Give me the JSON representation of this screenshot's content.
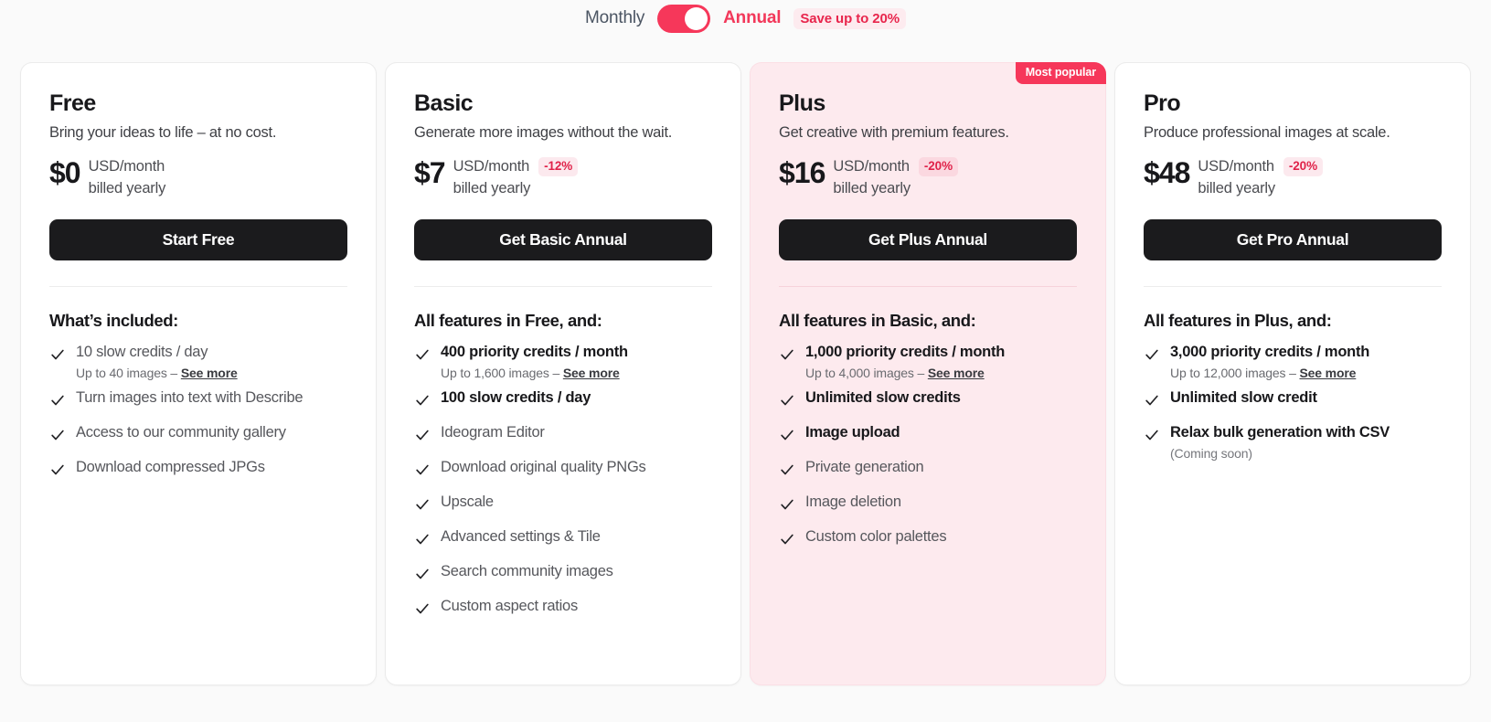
{
  "billing_toggle": {
    "monthly_label": "Monthly",
    "annual_label": "Annual",
    "save_label": "Save up to 20%",
    "selected": "Annual",
    "accent_color": "#f6375a",
    "save_bg_color": "#fdebef"
  },
  "badge": {
    "most_popular": "Most popular"
  },
  "plans": [
    {
      "name": "Free",
      "tagline": "Bring your ideas to life – at no cost.",
      "price": "$0",
      "unit": "USD/month",
      "billed": "billed yearly",
      "discount": "",
      "cta": "Start Free",
      "included_title": "What’s included:",
      "features": [
        {
          "text": "10 slow credits / day",
          "bold": false,
          "sub_prefix": "Up to 40 images – ",
          "sub_link": "See more"
        },
        {
          "text": "Turn images into text with Describe",
          "bold": false
        },
        {
          "text": "Access to our community gallery",
          "bold": false
        },
        {
          "text": "Download compressed JPGs",
          "bold": false
        }
      ]
    },
    {
      "name": "Basic",
      "tagline": "Generate more images without the wait.",
      "price": "$7",
      "unit": "USD/month",
      "billed": "billed yearly",
      "discount": "-12%",
      "cta": "Get Basic Annual",
      "included_title": "All features in Free, and:",
      "features": [
        {
          "text": "400 priority credits / month",
          "bold": true,
          "sub_prefix": "Up to 1,600 images – ",
          "sub_link": "See more"
        },
        {
          "text": "100 slow credits / day",
          "bold": true
        },
        {
          "text": "Ideogram Editor",
          "bold": false
        },
        {
          "text": "Download original quality PNGs",
          "bold": false
        },
        {
          "text": "Upscale",
          "bold": false
        },
        {
          "text": "Advanced settings & Tile",
          "bold": false
        },
        {
          "text": "Search community images",
          "bold": false
        },
        {
          "text": "Custom aspect ratios",
          "bold": false
        }
      ]
    },
    {
      "name": "Plus",
      "tagline": "Get creative with premium features.",
      "price": "$16",
      "unit": "USD/month",
      "billed": "billed yearly",
      "discount": "-20%",
      "cta": "Get Plus Annual",
      "included_title": "All features in Basic, and:",
      "highlight": true,
      "most_popular": true,
      "features": [
        {
          "text": "1,000 priority credits / month",
          "bold": true,
          "sub_prefix": "Up to 4,000 images – ",
          "sub_link": "See more"
        },
        {
          "text": "Unlimited slow credits",
          "bold": true
        },
        {
          "text": "Image upload",
          "bold": true
        },
        {
          "text": "Private generation",
          "bold": false
        },
        {
          "text": "Image deletion",
          "bold": false
        },
        {
          "text": "Custom color palettes",
          "bold": false
        }
      ]
    },
    {
      "name": "Pro",
      "tagline": "Produce professional images at scale.",
      "price": "$48",
      "unit": "USD/month",
      "billed": "billed yearly",
      "discount": "-20%",
      "cta": "Get Pro Annual",
      "included_title": "All features in Plus, and:",
      "features": [
        {
          "text": "3,000 priority credits / month",
          "bold": true,
          "sub_prefix": "Up to 12,000 images – ",
          "sub_link": "See more"
        },
        {
          "text": "Unlimited slow credit",
          "bold": true
        },
        {
          "text": "Relax bulk generation with CSV",
          "bold": true,
          "note": "(Coming soon)"
        }
      ]
    }
  ]
}
